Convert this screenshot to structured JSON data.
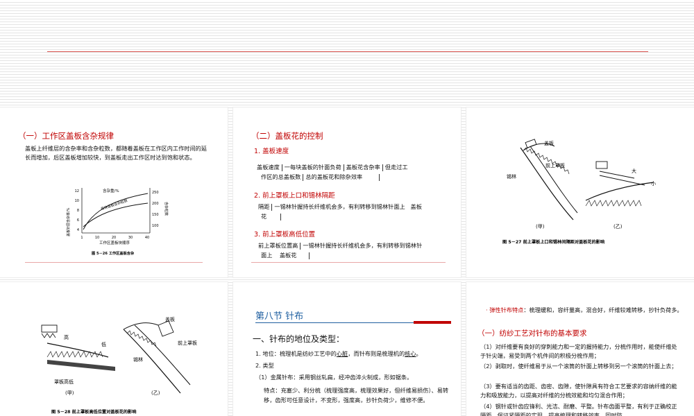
{
  "slide1": {
    "title": "（一）工作区盖板含杂规律",
    "body": "盖板上纤维层的含杂率和含杂粒数，都随着盖板在工作区内工作时间的延长而增加，后区盖板增加较快，到盖板走出工作区时达到饱和状态。",
    "chart": {
      "curve1_label": "含杂重/%",
      "curve2_label": "每块盖板含杂粒数",
      "ylabel_left": "盖板针层含杂率/%",
      "ylabel_right": "含杂粒数",
      "xlabel": "工作区盖板块顺序",
      "x_ticks": [
        "1",
        "10",
        "20",
        "30",
        "40"
      ],
      "y_left_ticks": [
        "4",
        "6",
        "8",
        "10",
        "12"
      ],
      "y_right_ticks": [
        "100",
        "150",
        "200",
        "250"
      ],
      "caption": "图 5－26  工作区盖板含杂"
    }
  },
  "slide2": {
    "title": "（二）盖板花的控制",
    "sub1": "1.  盖板速度",
    "line1a": "盖板速度",
    "line1b": "一每块盖板的针面负荷",
    "line1c": "盖板花含杂率",
    "line1d": "但走过工",
    "line1e": "作区的总盖板数",
    "line1f": "总的盖板花和除杂效率",
    "sub2": "2.  前上罩板上口和锡林隔距",
    "line2a": "隔距",
    "line2b": "一锡林针握持长纤维机会多，有利转移到锡林针面上",
    "line2c": "盖板",
    "line2d": "花",
    "sub3": "3.  前上罩板高低位置",
    "line3a": "前上罩板位置高",
    "line3b": "一锡林针握持长纤维机会多，有利转移到锡林针",
    "line3c": "面上",
    "line3d": "盖板花"
  },
  "slide3": {
    "labels": {
      "cover": "盖板",
      "front": "前上罩板",
      "cylinder": "锡林",
      "big": "大",
      "small": "小",
      "jia": "(甲)",
      "yi": "(乙)"
    },
    "caption": "图 5－27   前上罩板上口和锡林间隔距对盖板花的影响"
  },
  "slide4": {
    "labels": {
      "high": "高",
      "low": "低",
      "position": "罩板高低",
      "cover": "盖板",
      "front": "前上罩板",
      "cylinder": "锡林",
      "jia": "(甲)",
      "yi": "(乙)"
    },
    "caption": "图 5－28   前上罩板高低位置对盖板花的影响"
  },
  "slide5": {
    "section": "第八节   针布",
    "heading": "一、针布的地位及类型：",
    "p1_prefix": "1.  地位：梳理机是纺纱工艺中的",
    "p1_heart": "心脏",
    "p1_mid": "，而针布则是梳理机的",
    "p1_core": "核心",
    "p1_end": "。",
    "p2": "2.  类型",
    "p3": "（1）金属针布：采用钢丝轧扁，经冲齿淬火制成，形如锯条。",
    "p4": "特点：充塞少、利分梳（梳理强度高，梳理效果好，但纤维易损伤）、易转移，齿形可任意设计，不变形，强度高，抄针负荷少，维修不便。"
  },
  "slide6": {
    "elastic_label": "弹性针布特点",
    "elastic_text": "：梳理缓和，容纤量高，混合好，纤维较难转移，抄针负荷多。",
    "title": "（一）纺纱工艺对针布的基本要求",
    "r1": "（1）对纤维要有良好的穿刺能力和一定的握持能力，分梳作用时，能使纤维处于针尖端，易受到两个机件间的积极分梳作用；",
    "r2": "（2）剥取时，使纤维易于从一个滚筒的针面上转移到另一个滚筒的针面上去；",
    "r3": "（3）要有适当的齿距、齿密、齿隙，使针隙具有符合工艺要求的容纳纤维的能力和吸放能力，以提高对纤维的分梳效能和均匀混合作用；",
    "r4": "（4）钢针或针齿应锋利、光洁、耐磨、平整。针布齿面平整，有利于正确校正隔距，保证紧隔距的实现，提高梳理和转移效率，同时防"
  }
}
